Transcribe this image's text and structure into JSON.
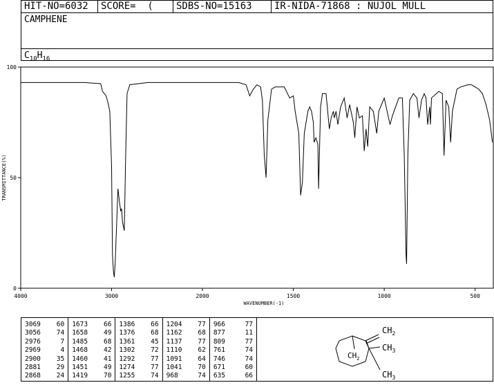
{
  "header": {
    "hit_no": "HIT-NO=6032",
    "score": "SCORE=  (   )",
    "sdbs_no": "SDBS-NO=15163",
    "ir_nida": "IR-NIDA-71868 : NUJOL MULL",
    "compound": "CAMPHENE",
    "formula": {
      "C": "C",
      "c_count": "10",
      "H": "H",
      "h_count": "16"
    }
  },
  "chart_data": {
    "type": "line",
    "title": "",
    "xlabel": "WAVENUMBER(-1)",
    "ylabel": "TRANSMITTANCE(%)",
    "xlim": [
      4000,
      400
    ],
    "ylim": [
      0,
      100
    ],
    "x_ticks": [
      4000,
      3000,
      2000,
      1500,
      1000,
      500
    ],
    "y_ticks": [
      0,
      50,
      100
    ],
    "baseline": [
      [
        4000,
        93
      ],
      [
        3700,
        93
      ],
      [
        3300,
        93
      ],
      [
        3120,
        92.5
      ],
      [
        3100,
        89
      ],
      [
        3080,
        88
      ],
      [
        3060,
        87
      ],
      [
        3040,
        84
      ],
      [
        3020,
        80
      ],
      [
        3000,
        55
      ],
      [
        2990,
        15
      ],
      [
        2980,
        8
      ],
      [
        2970,
        5
      ],
      [
        2960,
        12
      ],
      [
        2930,
        45
      ],
      [
        2910,
        38
      ],
      [
        2900,
        35
      ],
      [
        2890,
        36
      ],
      [
        2880,
        30
      ],
      [
        2870,
        28
      ],
      [
        2860,
        26
      ],
      [
        2845,
        60
      ],
      [
        2830,
        88
      ],
      [
        2800,
        92
      ],
      [
        2600,
        93
      ],
      [
        2200,
        93
      ],
      [
        1800,
        93
      ],
      [
        1760,
        92
      ],
      [
        1740,
        87
      ],
      [
        1720,
        90
      ],
      [
        1700,
        92
      ],
      [
        1680,
        91
      ],
      [
        1670,
        85
      ],
      [
        1660,
        60
      ],
      [
        1650,
        50
      ],
      [
        1640,
        76
      ],
      [
        1620,
        90
      ],
      [
        1600,
        91
      ],
      [
        1550,
        91
      ],
      [
        1520,
        86
      ],
      [
        1500,
        87
      ],
      [
        1490,
        80
      ],
      [
        1470,
        70
      ],
      [
        1460,
        42
      ],
      [
        1450,
        48
      ],
      [
        1440,
        70
      ],
      [
        1430,
        75
      ],
      [
        1420,
        80
      ],
      [
        1410,
        82
      ],
      [
        1400,
        80
      ],
      [
        1390,
        75
      ],
      [
        1386,
        66
      ],
      [
        1376,
        68
      ],
      [
        1365,
        65
      ],
      [
        1361,
        45
      ],
      [
        1350,
        82
      ],
      [
        1340,
        88
      ],
      [
        1320,
        88
      ],
      [
        1302,
        72
      ],
      [
        1292,
        77
      ],
      [
        1280,
        80
      ],
      [
        1274,
        77
      ],
      [
        1265,
        80
      ],
      [
        1255,
        74
      ],
      [
        1240,
        82
      ],
      [
        1220,
        86
      ],
      [
        1204,
        77
      ],
      [
        1190,
        83
      ],
      [
        1170,
        75
      ],
      [
        1162,
        68
      ],
      [
        1150,
        82
      ],
      [
        1137,
        77
      ],
      [
        1120,
        78
      ],
      [
        1110,
        62
      ],
      [
        1100,
        72
      ],
      [
        1091,
        64
      ],
      [
        1080,
        82
      ],
      [
        1060,
        80
      ],
      [
        1041,
        70
      ],
      [
        1030,
        80
      ],
      [
        1000,
        86
      ],
      [
        968,
        74
      ],
      [
        955,
        78
      ],
      [
        920,
        86
      ],
      [
        900,
        86
      ],
      [
        890,
        60
      ],
      [
        880,
        15
      ],
      [
        877,
        11
      ],
      [
        870,
        60
      ],
      [
        860,
        85
      ],
      [
        840,
        88
      ],
      [
        820,
        86
      ],
      [
        809,
        77
      ],
      [
        795,
        85
      ],
      [
        780,
        88
      ],
      [
        770,
        86
      ],
      [
        761,
        74
      ],
      [
        750,
        82
      ],
      [
        746,
        74
      ],
      [
        740,
        86
      ],
      [
        700,
        89
      ],
      [
        680,
        88
      ],
      [
        671,
        60
      ],
      [
        660,
        85
      ],
      [
        645,
        82
      ],
      [
        635,
        66
      ],
      [
        625,
        80
      ],
      [
        600,
        90
      ],
      [
        580,
        91
      ],
      [
        540,
        92
      ],
      [
        520,
        92
      ],
      [
        500,
        91
      ],
      [
        480,
        90
      ],
      [
        460,
        88
      ],
      [
        440,
        83
      ],
      [
        420,
        76
      ],
      [
        405,
        66
      ]
    ],
    "peaks": [
      {
        "wavenumber": 3069,
        "transmittance": 60
      },
      {
        "wavenumber": 3056,
        "transmittance": 74
      },
      {
        "wavenumber": 2976,
        "transmittance": 7
      },
      {
        "wavenumber": 2969,
        "transmittance": 4
      },
      {
        "wavenumber": 2900,
        "transmittance": 35
      },
      {
        "wavenumber": 2881,
        "transmittance": 29
      },
      {
        "wavenumber": 2868,
        "transmittance": 24
      },
      {
        "wavenumber": 1673,
        "transmittance": 66
      },
      {
        "wavenumber": 1658,
        "transmittance": 49
      },
      {
        "wavenumber": 1485,
        "transmittance": 68
      },
      {
        "wavenumber": 1468,
        "transmittance": 42
      },
      {
        "wavenumber": 1460,
        "transmittance": 41
      },
      {
        "wavenumber": 1451,
        "transmittance": 49
      },
      {
        "wavenumber": 1419,
        "transmittance": 70
      },
      {
        "wavenumber": 1386,
        "transmittance": 66
      },
      {
        "wavenumber": 1376,
        "transmittance": 68
      },
      {
        "wavenumber": 1361,
        "transmittance": 45
      },
      {
        "wavenumber": 1302,
        "transmittance": 72
      },
      {
        "wavenumber": 1292,
        "transmittance": 77
      },
      {
        "wavenumber": 1274,
        "transmittance": 77
      },
      {
        "wavenumber": 1255,
        "transmittance": 74
      },
      {
        "wavenumber": 1204,
        "transmittance": 77
      },
      {
        "wavenumber": 1162,
        "transmittance": 68
      },
      {
        "wavenumber": 1137,
        "transmittance": 77
      },
      {
        "wavenumber": 1110,
        "transmittance": 62
      },
      {
        "wavenumber": 1091,
        "transmittance": 64
      },
      {
        "wavenumber": 1041,
        "transmittance": 70
      },
      {
        "wavenumber": 968,
        "transmittance": 74
      },
      {
        "wavenumber": 966,
        "transmittance": 77
      },
      {
        "wavenumber": 877,
        "transmittance": 11
      },
      {
        "wavenumber": 809,
        "transmittance": 77
      },
      {
        "wavenumber": 761,
        "transmittance": 74
      },
      {
        "wavenumber": 746,
        "transmittance": 74
      },
      {
        "wavenumber": 671,
        "transmittance": 60
      },
      {
        "wavenumber": 635,
        "transmittance": 66
      }
    ]
  },
  "peak_table": [
    [
      [
        "3069",
        "60"
      ],
      [
        "3056",
        "74"
      ],
      [
        "2976",
        "7"
      ],
      [
        "2969",
        "4"
      ],
      [
        "2900",
        "35"
      ],
      [
        "2881",
        "29"
      ],
      [
        "2868",
        "24"
      ]
    ],
    [
      [
        "1673",
        "66"
      ],
      [
        "1658",
        "49"
      ],
      [
        "1485",
        "68"
      ],
      [
        "1468",
        "42"
      ],
      [
        "1460",
        "41"
      ],
      [
        "1451",
        "49"
      ],
      [
        "1419",
        "70"
      ]
    ],
    [
      [
        "1386",
        "66"
      ],
      [
        "1376",
        "68"
      ],
      [
        "1361",
        "45"
      ],
      [
        "1302",
        "72"
      ],
      [
        "1292",
        "77"
      ],
      [
        "1274",
        "77"
      ],
      [
        "1255",
        "74"
      ]
    ],
    [
      [
        "1204",
        "77"
      ],
      [
        "1162",
        "68"
      ],
      [
        "1137",
        "77"
      ],
      [
        "1110",
        "62"
      ],
      [
        "1091",
        "64"
      ],
      [
        "1041",
        "70"
      ],
      [
        "968",
        "74"
      ]
    ],
    [
      [
        "966",
        "77"
      ],
      [
        "877",
        "11"
      ],
      [
        "809",
        "77"
      ],
      [
        "761",
        "74"
      ],
      [
        "746",
        "74"
      ],
      [
        "671",
        "60"
      ],
      [
        "635",
        "66"
      ]
    ]
  ],
  "structure": {
    "ch2_top": "CH",
    "ch2_top_sub": "2",
    "ch3_a": "CH",
    "ch3_a_sub": "3",
    "ch2_bridge": "CH",
    "ch2_bridge_sub": "2",
    "ch3_b": "CH",
    "ch3_b_sub": "3"
  }
}
